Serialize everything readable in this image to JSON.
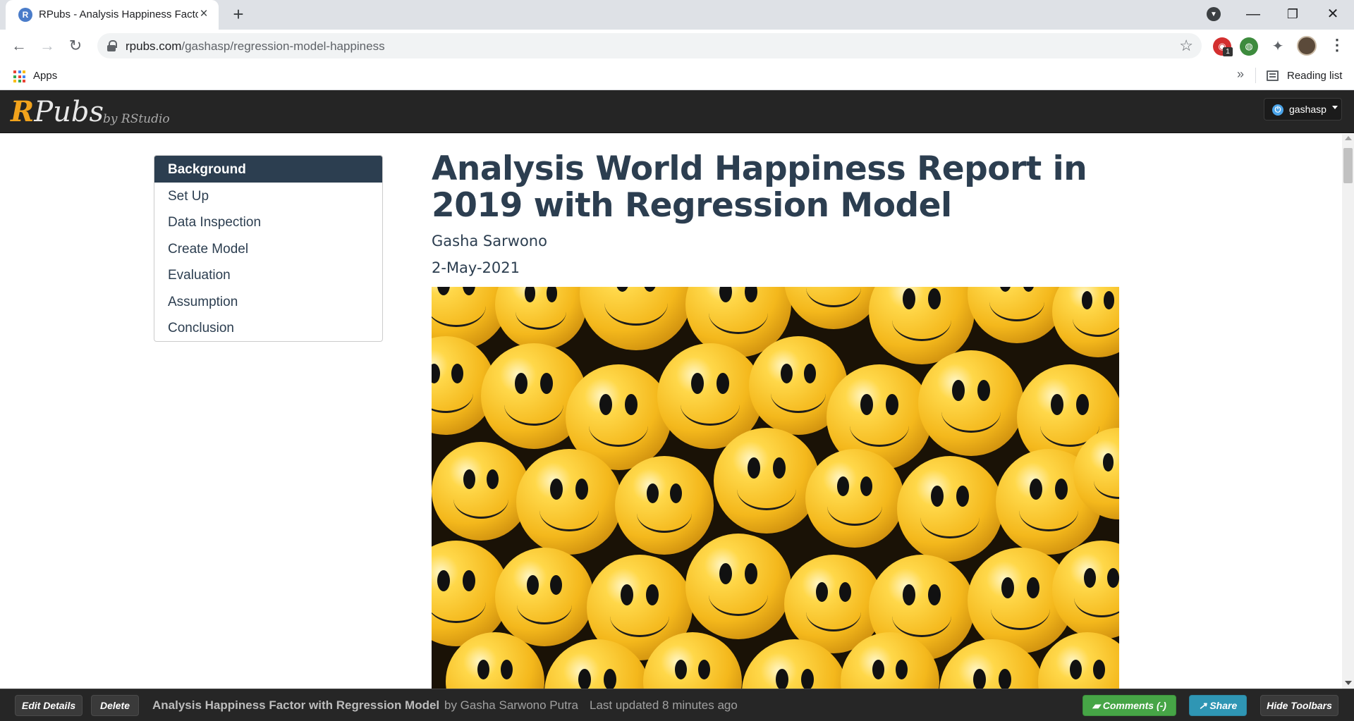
{
  "browser": {
    "tab_title": "RPubs - Analysis Happiness Factor with Regression Model",
    "url_host": "rpubs.com",
    "url_path": "/gashasp/regression-model-happiness",
    "bookmarks": {
      "apps_label": "Apps",
      "reading_list_label": "Reading list"
    },
    "extension_badge": "1"
  },
  "rpubs": {
    "logo_r": "R",
    "logo_rest": "Pubs",
    "logo_by": "by RStudio",
    "user": "gashasp"
  },
  "toc": {
    "items": [
      {
        "label": "Background",
        "active": true
      },
      {
        "label": "Set Up"
      },
      {
        "label": "Data Inspection"
      },
      {
        "label": "Create Model"
      },
      {
        "label": "Evaluation"
      },
      {
        "label": "Assumption"
      },
      {
        "label": "Conclusion"
      }
    ]
  },
  "document": {
    "title": "Analysis World Happiness Report in 2019 with Regression Model",
    "author": "Gasha Sarwono",
    "date": "2-May-2021"
  },
  "bottom_bar": {
    "edit_details": "Edit Details",
    "delete": "Delete",
    "doc_title": "Analysis Happiness Factor with Regression Model",
    "by_author": "by Gasha Sarwono Putra",
    "last_updated": "Last updated 8 minutes ago",
    "comments": "Comments (-)",
    "share": "Share",
    "hide_toolbars": "Hide Toolbars"
  }
}
